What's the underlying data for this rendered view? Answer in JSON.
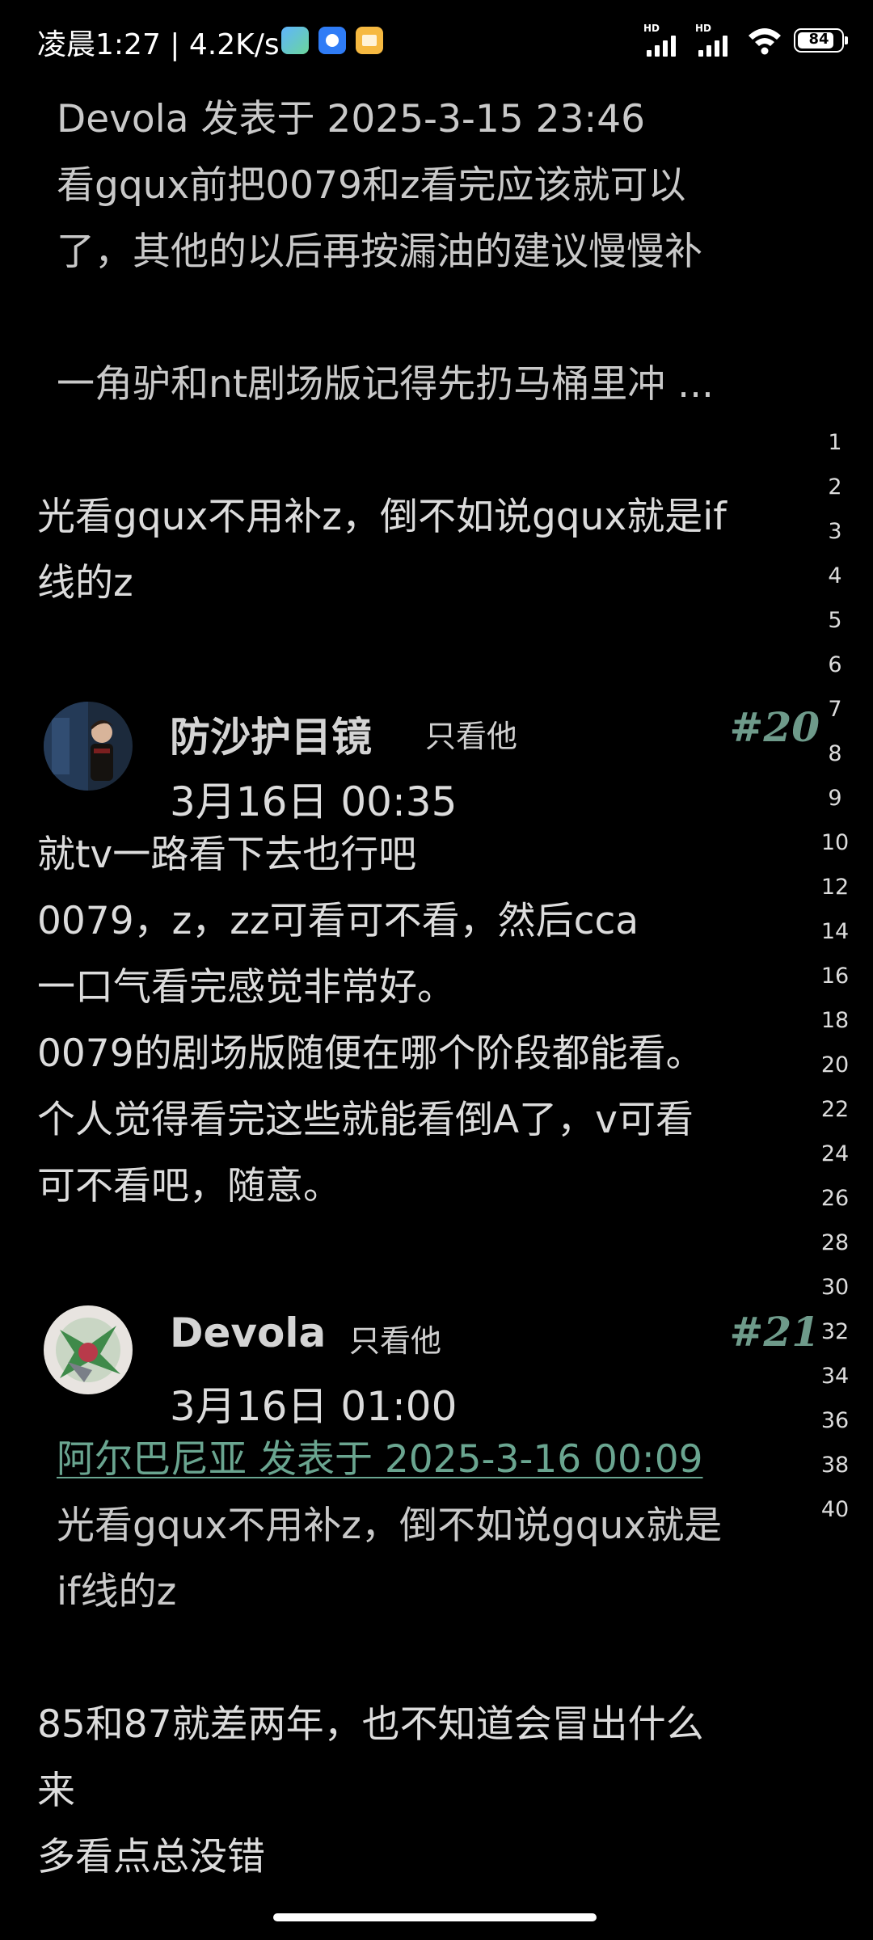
{
  "status_bar": {
    "time_speed": "凌晨1:27 | 4.2K/s",
    "network_label_1": "HD",
    "network_label_2": "HD",
    "battery_level": "84",
    "battery_fraction": 0.84
  },
  "content": {
    "quote_block_1": {
      "header": "Devola 发表于 2025-3-15 23:46",
      "lines": [
        "看gqux前把0079和z看完应该就可以",
        "了，其他的以后再按漏油的建议慢慢补",
        "一角驴和nt剧场版记得先扔马桶里冲 ..."
      ]
    },
    "reply_block_1": {
      "lines": [
        "光看gqux不用补z，倒不如说gqux就是if",
        "线的z"
      ]
    },
    "posts": [
      {
        "username": "防沙护目镜",
        "only_him": "只看他",
        "floor": "#20",
        "time": "3月16日 00:35",
        "lines": [
          "就tv一路看下去也行吧",
          "0079，z，zz可看可不看，然后cca",
          "一口气看完感觉非常好。",
          "0079的剧场版随便在哪个阶段都能看。",
          "个人觉得看完这些就能看倒A了，v可看",
          "可不看吧，随意。"
        ]
      },
      {
        "username": "Devola",
        "only_him": "只看他",
        "floor": "#21",
        "time": "3月16日 01:00",
        "quote_header": "阿尔巴尼亚 发表于 2025-3-16 00:09",
        "quote_lines": [
          "光看gqux不用补z，倒不如说gqux就是",
          "if线的z"
        ],
        "lines": [
          "85和87就差两年，也不知道会冒出什么",
          "来",
          "多看点总没错"
        ]
      }
    ]
  },
  "page_index": [
    "1",
    "2",
    "3",
    "4",
    "5",
    "6",
    "7",
    "8",
    "9",
    "10",
    "12",
    "14",
    "16",
    "18",
    "20",
    "22",
    "24",
    "26",
    "28",
    "30",
    "32",
    "34",
    "36",
    "38",
    "40"
  ],
  "colors": {
    "background": "#000000",
    "text": "#dcdcdc",
    "floor_number": "#6e9a8a",
    "quote_link": "#6aa590"
  }
}
